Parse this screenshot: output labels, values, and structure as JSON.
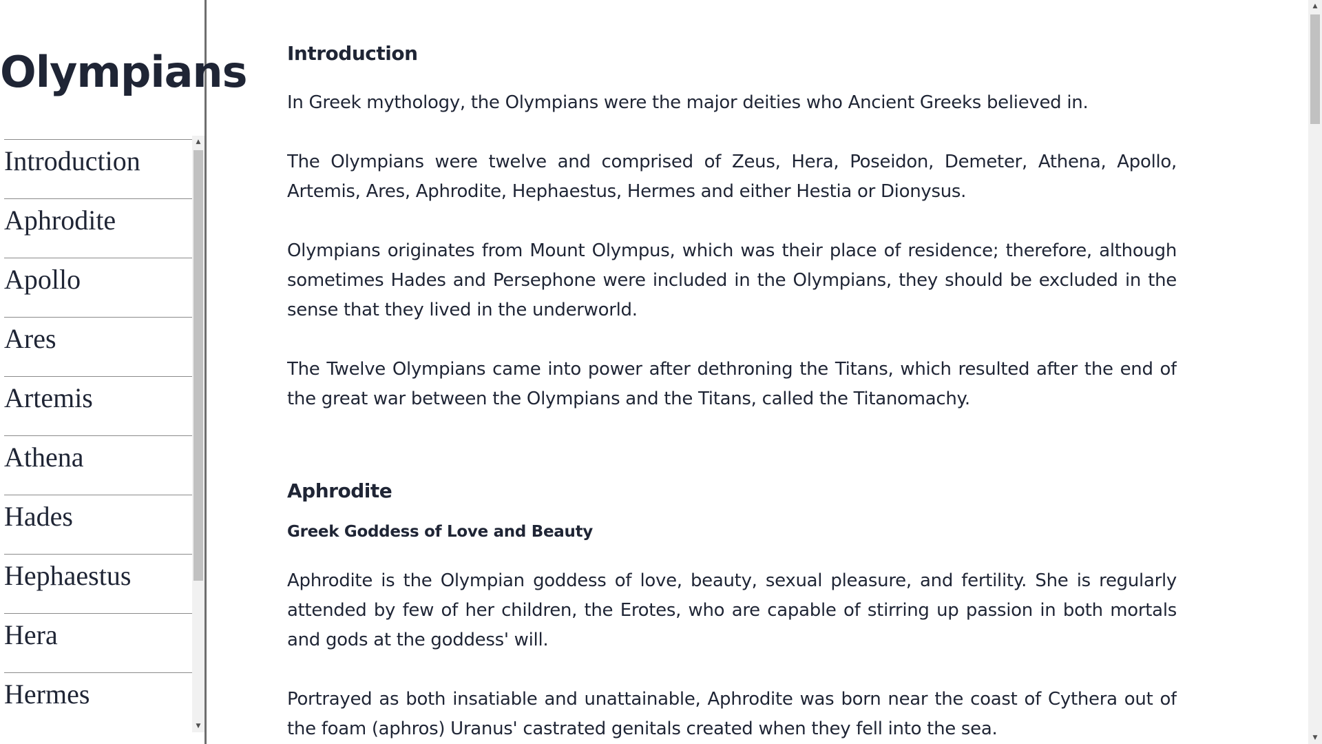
{
  "nav": {
    "title": "Olympians",
    "items": [
      {
        "label": "Introduction"
      },
      {
        "label": "Aphrodite"
      },
      {
        "label": "Apollo"
      },
      {
        "label": "Ares"
      },
      {
        "label": "Artemis"
      },
      {
        "label": "Athena"
      },
      {
        "label": "Hades"
      },
      {
        "label": "Hephaestus"
      },
      {
        "label": "Hera"
      },
      {
        "label": "Hermes"
      }
    ],
    "scroll_up_icon": "▲",
    "scroll_down_icon": "▼"
  },
  "main": {
    "introduction": {
      "title": "Introduction",
      "paragraphs": [
        "In Greek mythology, the Olympians were the major deities who Ancient Greeks believed in.",
        "The Olympians were twelve and comprised of Zeus, Hera, Poseidon, Demeter, Athena, Apollo, Artemis, Ares, Aphrodite, Hephaestus, Hermes and either Hestia or Dionysus.",
        "Olympians originates from Mount Olympus, which was their place of residence; therefore, although sometimes Hades and Persephone were included in the Olympians, they should be excluded in the sense that they lived in the underworld.",
        "The Twelve Olympians came into power after dethroning the Titans, which resulted after the end of the great war between the Olympians and the Titans, called the Titanomachy."
      ]
    },
    "aphrodite": {
      "title": "Aphrodite",
      "subtitle": "Greek Goddess of Love and Beauty",
      "paragraphs": [
        "Aphrodite is the Olympian goddess of love, beauty, sexual pleasure, and fertility. She is regularly attended by few of her children, the Erotes, who are capable of stirring up passion in both mortals and gods at the goddess' will.",
        "Portrayed as both insatiable and unattainable, Aphrodite was born near the coast of Cythera out of the foam (aphros) Uranus' castrated genitals created when they fell into the sea."
      ]
    }
  },
  "page_scrollbar": {
    "up_icon": "▲",
    "down_icon": "▼"
  },
  "colors": {
    "text": "#1f2535",
    "divider": "#8a8a8a",
    "scrollbar_track": "#f1f1f1",
    "scrollbar_thumb": "#c1c1c1"
  }
}
